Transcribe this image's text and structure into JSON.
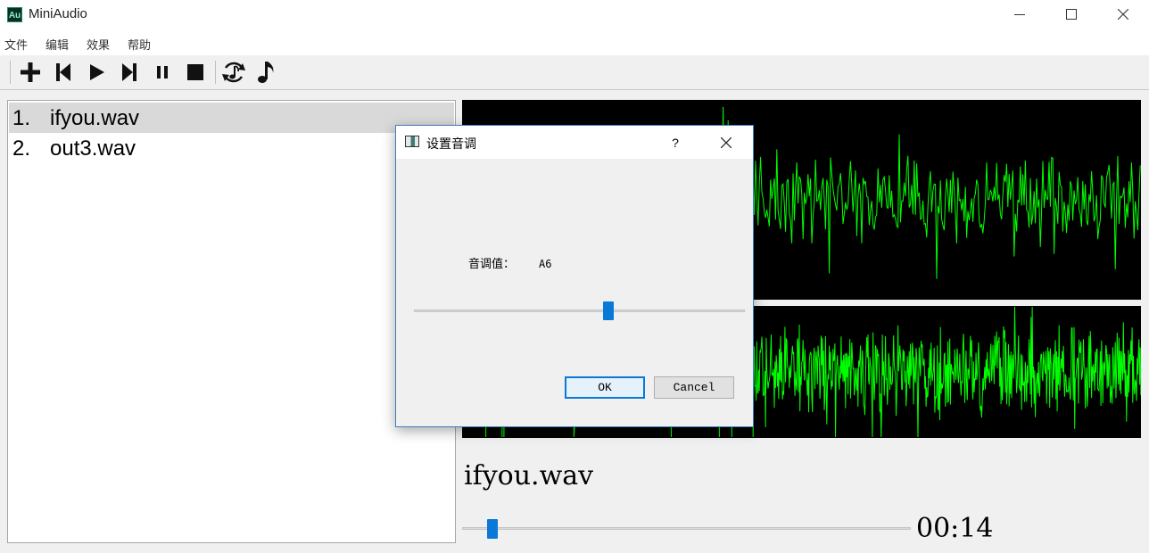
{
  "window": {
    "title": "MiniAudio",
    "app_icon_text": "Au",
    "controls": [
      "minimize",
      "maximize",
      "close"
    ]
  },
  "menu": [
    "文件",
    "编辑",
    "效果",
    "帮助"
  ],
  "toolbar": {
    "buttons": [
      "add-icon",
      "previous-track-icon",
      "play-icon",
      "next-track-icon",
      "pause-icon",
      "stop-icon",
      "pitch-cycle-icon",
      "music-note-icon"
    ]
  },
  "playlist": {
    "items": [
      {
        "num": "1.",
        "name": "ifyou.wav",
        "selected": true
      },
      {
        "num": "2.",
        "name": "out3.wav",
        "selected": false
      }
    ]
  },
  "waveform": {
    "color": "#00ff00",
    "background": "#000000"
  },
  "player": {
    "now_playing": "ifyou.wav",
    "time": "00:14",
    "progress": 0.05
  },
  "dialog": {
    "title": "设置音调",
    "help": "?",
    "pitch_label": "音调值：",
    "pitch_value": "A6",
    "slider_position": 0.59,
    "ok": "OK",
    "cancel": "Cancel",
    "accent": "#0a78d7"
  }
}
